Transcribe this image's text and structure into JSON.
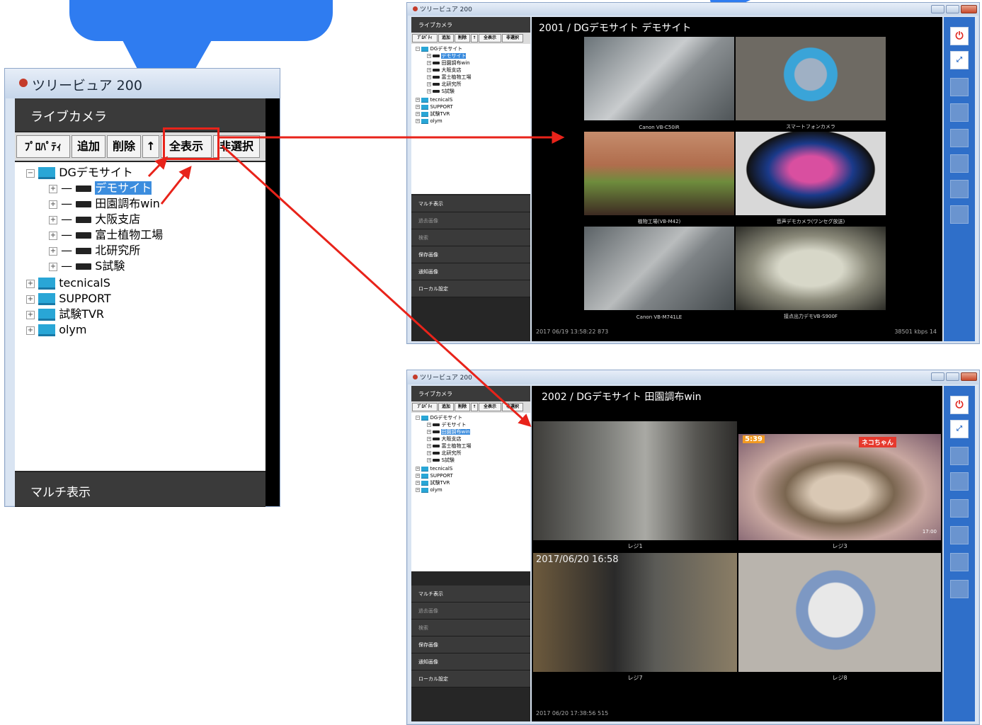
{
  "enlarged": {
    "title": "ツリービュア 200",
    "section": "ライブカメラ",
    "toolbar": [
      "ﾌﾟﾛﾊﾟﾃｨ",
      "追加",
      "削除",
      "↑",
      "全表示",
      "非選択"
    ],
    "tree": {
      "root": "DGデモサイト",
      "children": [
        "デモサイト",
        "田園調布win",
        "大阪支店",
        "富士植物工場",
        "北研究所",
        "S試験"
      ],
      "others": [
        "tecnicalS",
        "SUPPORT",
        "試験TVR",
        "olym"
      ]
    },
    "menu": "マルチ表示"
  },
  "window1": {
    "title": "ツリービュア 200",
    "section": "ライブカメラ",
    "toolbar": [
      "ﾌﾟﾛﾊﾟﾃｨ",
      "追加",
      "削除",
      "↑",
      "全表示",
      "非選択"
    ],
    "tree": {
      "root": "DGデモサイト",
      "children": [
        "デモサイト",
        "田園調布win",
        "大阪支店",
        "富士植物工場",
        "北研究所",
        "S試験"
      ],
      "others": [
        "tecnicalS",
        "SUPPORT",
        "試験TVR",
        "olym"
      ]
    },
    "menu": [
      "マルチ表示",
      "過去画像",
      "検索",
      "保存画像",
      "通知画像",
      "ローカル設定"
    ],
    "viewer": {
      "title": "2001 / DGデモサイト デモサイト",
      "cams": [
        "Canon VB-C50iR",
        "スマートフォンカメラ",
        "植物工場(VB-M42)",
        "音声デモカメラ(ワンセグ放送)",
        "Canon VB-M741LE",
        "接点出力デモVB-S900F"
      ],
      "timestamp": "2017 06/19 13:58:22 873",
      "rate": "38501 kbps 14"
    }
  },
  "window2": {
    "title": "ツリービュア 200",
    "section": "ライブカメラ",
    "toolbar": [
      "ﾌﾟﾛﾊﾟﾃｨ",
      "追加",
      "削除",
      "↑",
      "全表示",
      "非選択"
    ],
    "tree": {
      "root": "DGデモサイト",
      "children": [
        "デモサイト",
        "田園調布win",
        "大阪支店",
        "富士植物工場",
        "北研究所",
        "S試験"
      ],
      "others": [
        "tecnicalS",
        "SUPPORT",
        "試験TVR",
        "olym"
      ]
    },
    "menu": [
      "マルチ表示",
      "過去画像",
      "検索",
      "保存画像",
      "通知画像",
      "ローカル設定"
    ],
    "viewer": {
      "title": "2002 / DGデモサイト 田園調布win",
      "cams": [
        "レジ1",
        "レジ3",
        "レジ7",
        "レジ8"
      ],
      "overlay_time": "2017/06/20 16:58",
      "tv_time": "5:39",
      "tv_clock": "17:00",
      "tv_text": "ネコちゃん",
      "timestamp": "2017 06/20 17:38:56 515"
    }
  },
  "colors": {
    "callout": "#2f7cf0",
    "arrow": "#e8231a",
    "highlight": "#e8231a"
  }
}
